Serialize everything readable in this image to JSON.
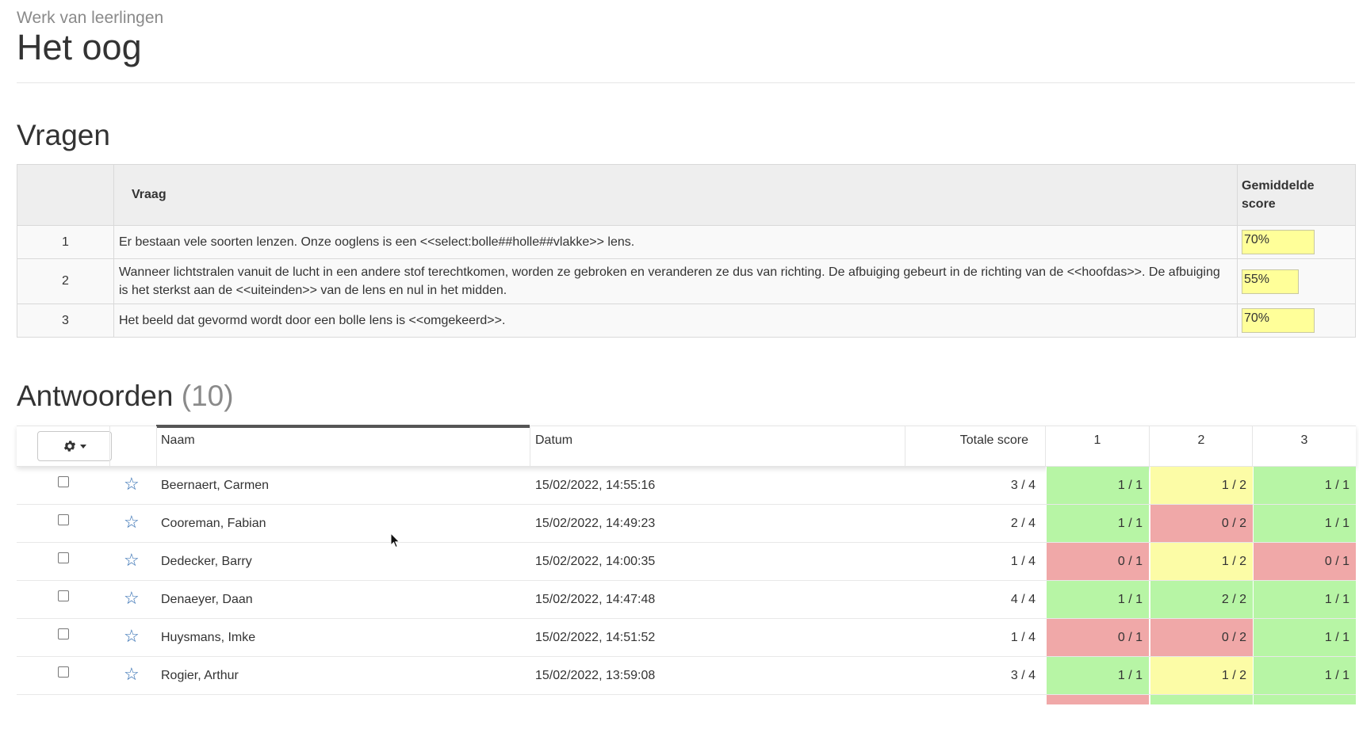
{
  "page": {
    "subtitle": "Werk van leerlingen",
    "title": "Het oog"
  },
  "vragen": {
    "heading": "Vragen",
    "header_vraag": "Vraag",
    "header_score": "Gemiddelde score",
    "rows": [
      {
        "num": "1",
        "text": "Er bestaan vele soorten lenzen. Onze ooglens is een <<select:bolle##holle##vlakke>> lens.",
        "score": "70%"
      },
      {
        "num": "2",
        "text": "Wanneer lichtstralen vanuit de lucht in een andere stof terechtkomen, worden ze gebroken en veranderen ze dus van richting. De afbuiging gebeurt in de richting van de <<hoofdas>>. De afbuiging is het sterkst aan de <<uiteinden>> van de lens en nul in het midden.",
        "score": "55%"
      },
      {
        "num": "3",
        "text": "Het beeld dat gevormd wordt door een bolle lens is <<omgekeerd>>.",
        "score": "70%"
      }
    ]
  },
  "antwoorden": {
    "heading": "Antwoorden",
    "count": "(10)",
    "columns": {
      "naam": "Naam",
      "datum": "Datum",
      "totaal": "Totale score",
      "q1": "1",
      "q2": "2",
      "q3": "3"
    },
    "rows": [
      {
        "naam": "Beernaert, Carmen",
        "datum": "15/02/2022, 14:55:16",
        "totaal": "3 / 4",
        "q1": "1 / 1",
        "q2": "1 / 2",
        "q3": "1 / 1",
        "c1": "green",
        "c2": "yellow",
        "c3": "green"
      },
      {
        "naam": "Cooreman, Fabian",
        "datum": "15/02/2022, 14:49:23",
        "totaal": "2 / 4",
        "q1": "1 / 1",
        "q2": "0 / 2",
        "q3": "1 / 1",
        "c1": "green",
        "c2": "red",
        "c3": "green"
      },
      {
        "naam": "Dedecker, Barry",
        "datum": "15/02/2022, 14:00:35",
        "totaal": "1 / 4",
        "q1": "0 / 1",
        "q2": "1 / 2",
        "q3": "0 / 1",
        "c1": "red",
        "c2": "yellow",
        "c3": "red"
      },
      {
        "naam": "Denaeyer, Daan",
        "datum": "15/02/2022, 14:47:48",
        "totaal": "4 / 4",
        "q1": "1 / 1",
        "q2": "2 / 2",
        "q3": "1 / 1",
        "c1": "green",
        "c2": "green",
        "c3": "green"
      },
      {
        "naam": "Huysmans, Imke",
        "datum": "15/02/2022, 14:51:52",
        "totaal": "1 / 4",
        "q1": "0 / 1",
        "q2": "0 / 2",
        "q3": "1 / 1",
        "c1": "red",
        "c2": "red",
        "c3": "green"
      },
      {
        "naam": "Rogier, Arthur",
        "datum": "15/02/2022, 13:59:08",
        "totaal": "3 / 4",
        "q1": "1 / 1",
        "q2": "1 / 2",
        "q3": "1 / 1",
        "c1": "green",
        "c2": "yellow",
        "c3": "green"
      }
    ],
    "partial_row_colors": {
      "c1": "red",
      "c2": "green",
      "c3": "green"
    }
  },
  "colors": {
    "green": "#b7f5a5",
    "yellow": "#fcfca6",
    "red": "#f0a8a8",
    "link": "#3a74b0"
  },
  "icons": {
    "settings": "gear-icon",
    "favorite": "star-outline-icon",
    "pointer": "mouse-cursor-icon"
  }
}
